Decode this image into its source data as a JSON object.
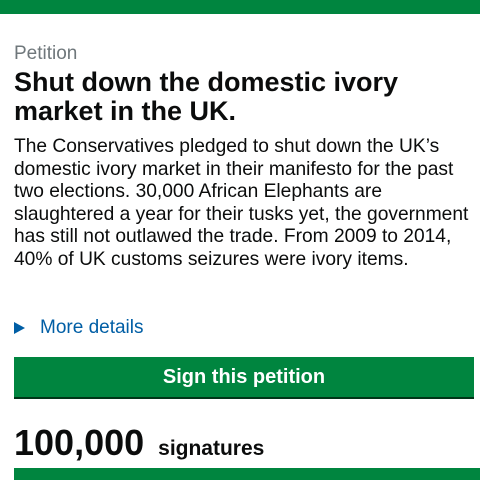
{
  "petition": {
    "eyebrow": "Petition",
    "title": "Shut down the domestic ivory market in the UK.",
    "summary": "The Conservatives pledged to shut down the UK’s domestic ivory market in their manifesto for the past two elections. 30,000 African Elephants are slaughtered a year for their tusks yet, the government has still not outlawed the trade. From 2009 to 2014, 40% of UK customs seizures were ivory items.",
    "more_details_label": "More details",
    "more_details_icon": "triangle-right-icon",
    "sign_button_label": "Sign this petition",
    "signature_count": "100,000",
    "signature_label": "signatures"
  },
  "colors": {
    "brand_green": "#00853f",
    "link_blue": "#005ea5",
    "text": "#0b0c0c",
    "secondary_text": "#6f777b"
  }
}
